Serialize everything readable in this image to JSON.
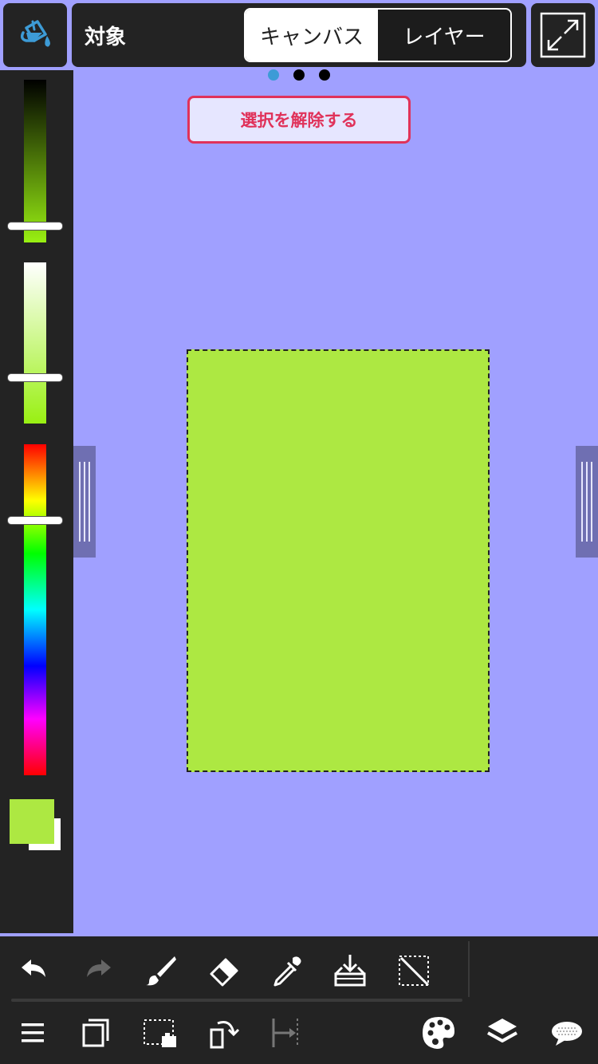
{
  "top_bar": {
    "target_label": "対象",
    "segment": {
      "canvas_label": "キャンバス",
      "layer_label": "レイヤー",
      "selected": "canvas_label"
    }
  },
  "pager": {
    "count": 3,
    "active_index": 0
  },
  "deselect_label": "選択を解除する",
  "colors": {
    "accent_blue": "#3d9bd6",
    "current_color": "#ade842",
    "canvas_background": "#a0a0ff",
    "deselect_red": "#e0325a"
  },
  "color_panel": {
    "value_level": 0.9,
    "saturation_level": 0.72,
    "hue_level": 0.2
  },
  "icons": {
    "fill": "paint-bucket-icon",
    "fullscreen": "expand-arrows-icon",
    "toolbar_row1": [
      "undo-icon",
      "redo-icon",
      "brush-icon",
      "eraser-icon",
      "eyedropper-icon",
      "import-tray-icon",
      "clear-selection-icon"
    ],
    "toolbar_row2": [
      "menu-icon",
      "layers-duplicate-icon",
      "selection-move-icon",
      "transform-icon",
      "snap-icon",
      "palette-icon",
      "layers-icon",
      "speech-bubble-icon"
    ]
  }
}
